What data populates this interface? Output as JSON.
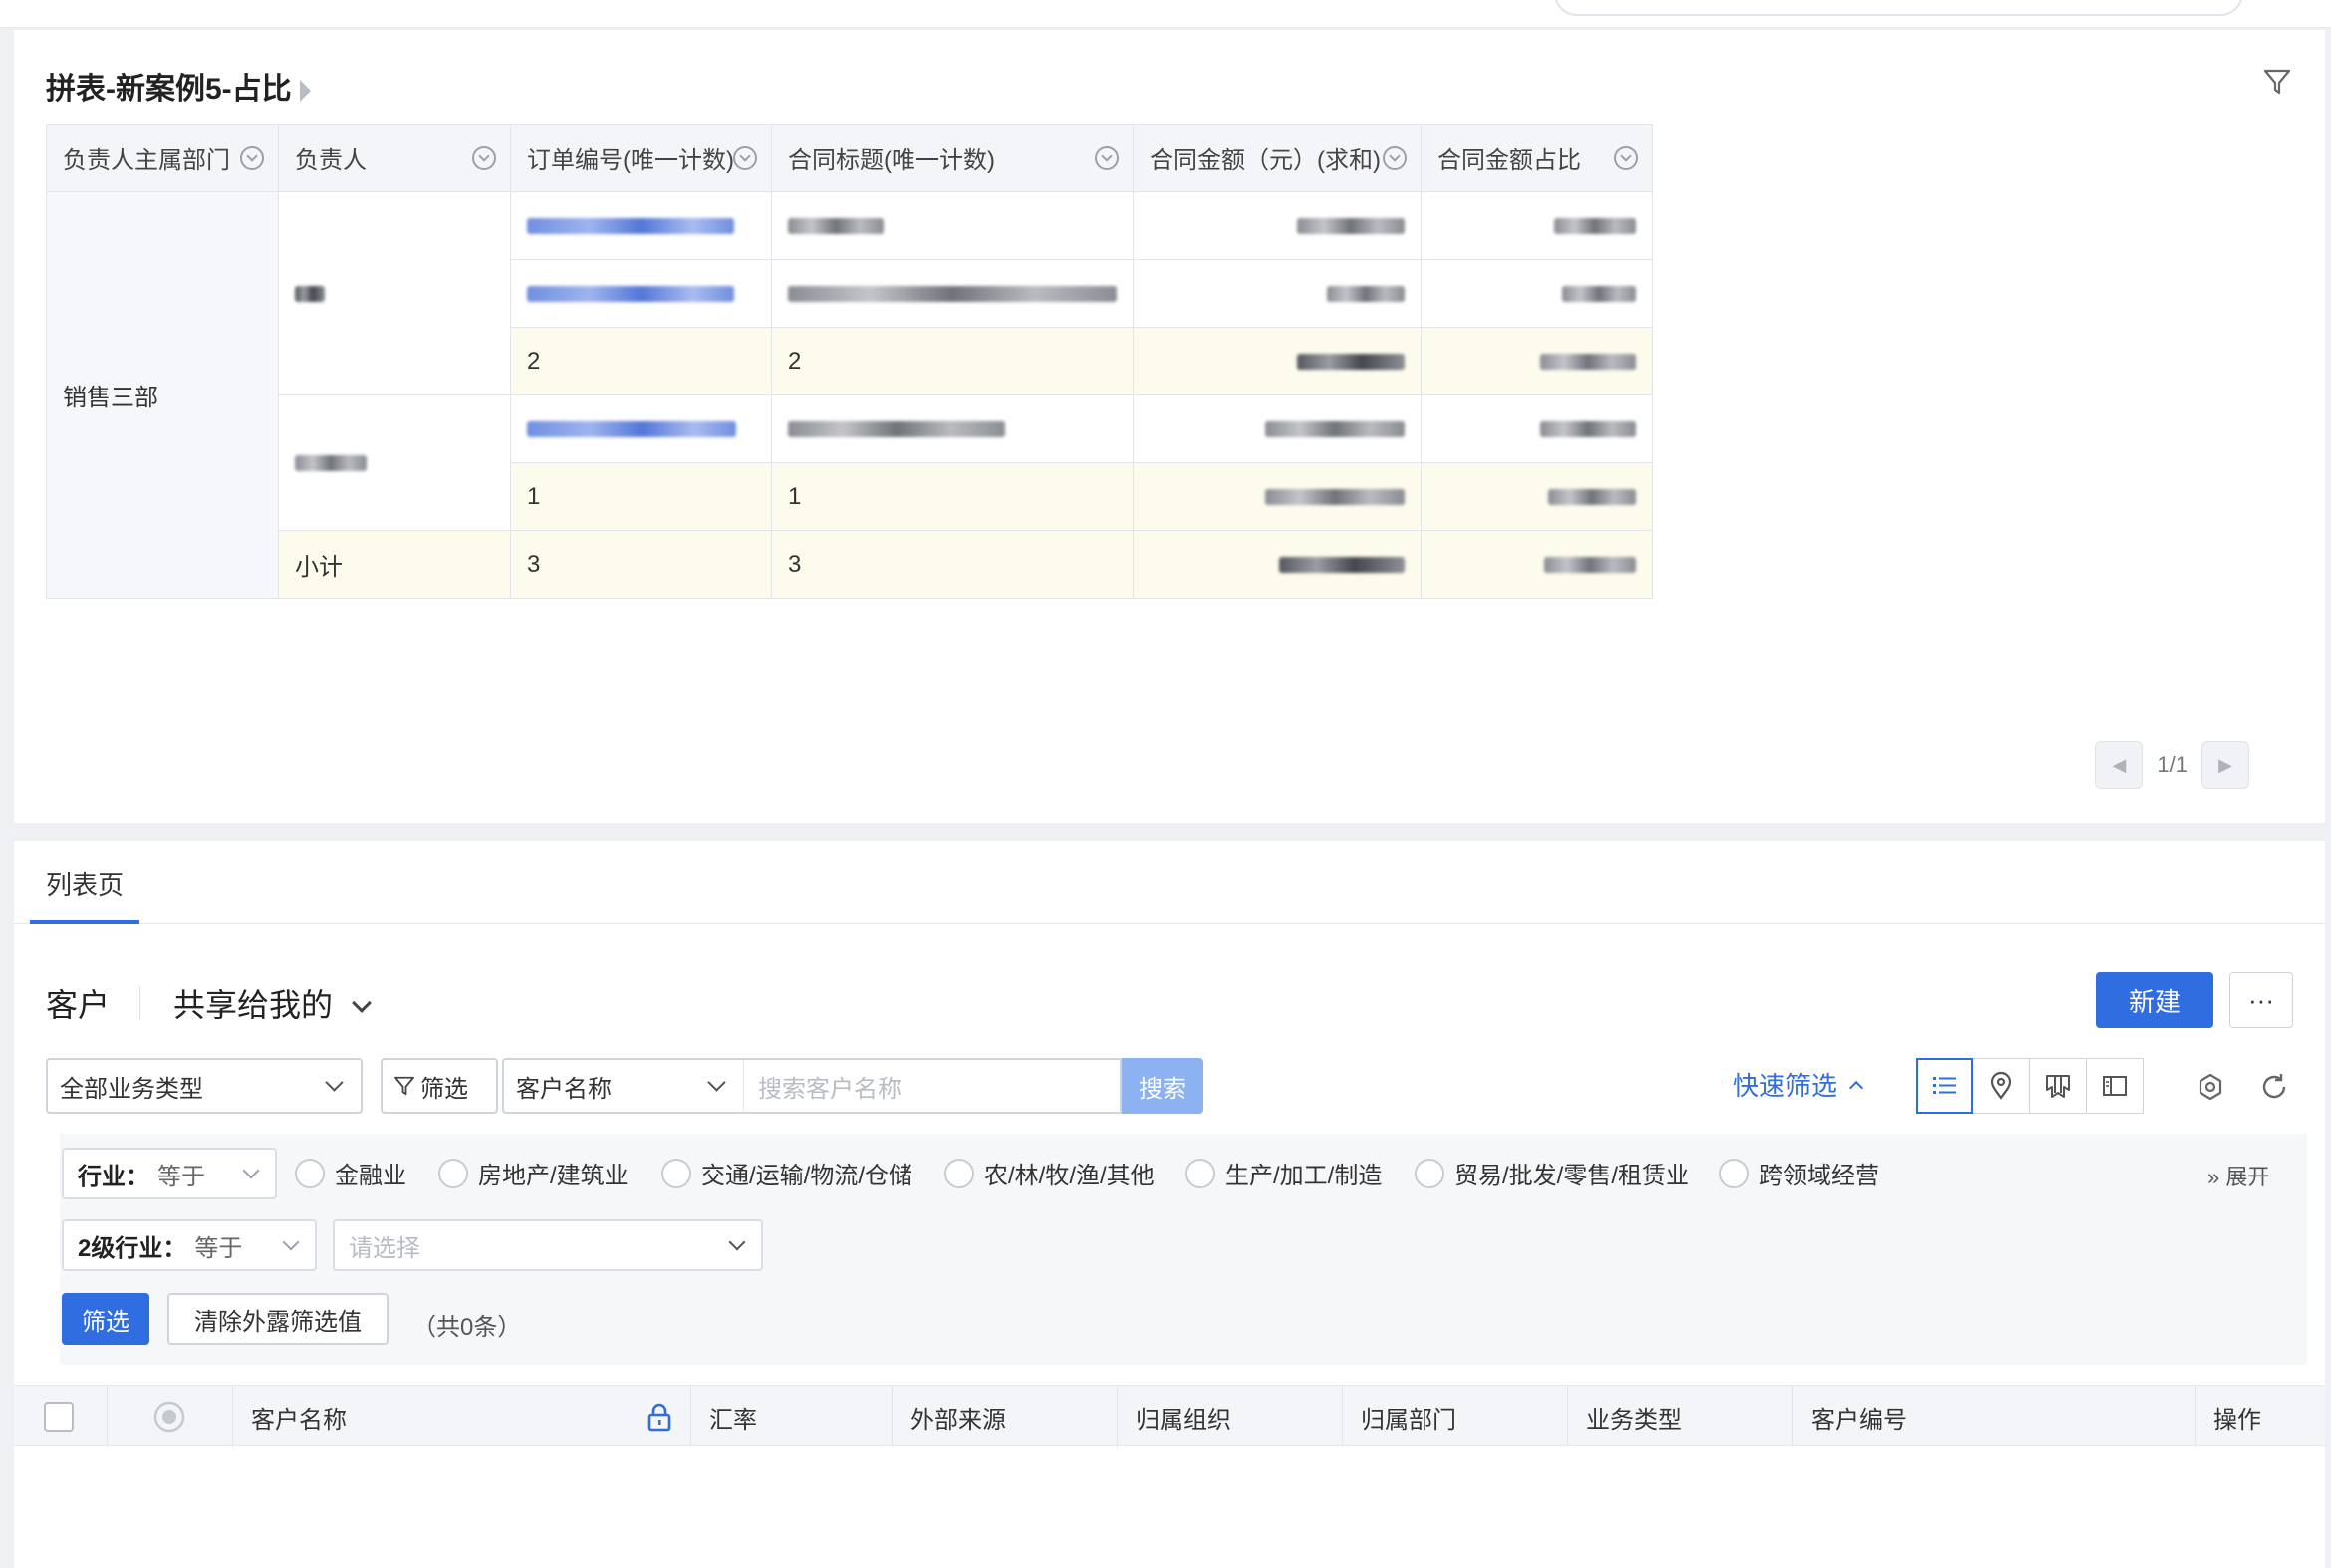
{
  "report": {
    "title": "拼表-新案例5-占比",
    "columns": [
      "负责人主属部门",
      "负责人",
      "订单编号(唯一计数)",
      "合同标题(唯一计数)",
      "合同金额（元）(求和)",
      "合同金额占比"
    ],
    "dept": "销售三部",
    "subtotal_person_1": "2",
    "subtotal_person_2": "1",
    "subtotal_label": "小计",
    "subtotal_dept": "3",
    "pager": "1/1"
  },
  "list": {
    "tab_label": "列表页",
    "object_name": "客户",
    "view_name": "共享给我的",
    "new_label": "新建",
    "more_label": "···",
    "business_type": "全部业务类型",
    "filter_label": "筛选",
    "search_field": "客户名称",
    "search_placeholder": "搜索客户名称",
    "search_button": "搜索",
    "quick_filter": "快速筛选",
    "industry_field": "行业：",
    "industry_op": "等于",
    "industry_options": [
      "金融业",
      "房地产/建筑业",
      "交通/运输/物流/仓储",
      "农/林/牧/渔/其他",
      "生产/加工/制造",
      "贸易/批发/零售/租赁业",
      "跨领域经营"
    ],
    "expand_label": "展开",
    "level2_field": "2级行业：",
    "level2_op": "等于",
    "level2_placeholder": "请选择",
    "apply_filter": "筛选",
    "clear_filter": "清除外露筛选值",
    "count_text": "（共0条）",
    "columns": [
      "客户名称",
      "汇率",
      "外部来源",
      "归属组织",
      "归属部门",
      "业务类型",
      "客户编号",
      "操作"
    ]
  },
  "icons": {
    "filter": "filter-funnel-icon",
    "list_view": "list-view-icon",
    "map_view": "map-pin-icon",
    "kanban_view": "kanban-icon",
    "split_view": "split-view-icon",
    "settings": "settings-icon",
    "refresh": "refresh-icon",
    "lock": "lock-icon"
  },
  "colors": {
    "primary": "#2f6de1",
    "subtotal_bg": "#fdfbec"
  }
}
